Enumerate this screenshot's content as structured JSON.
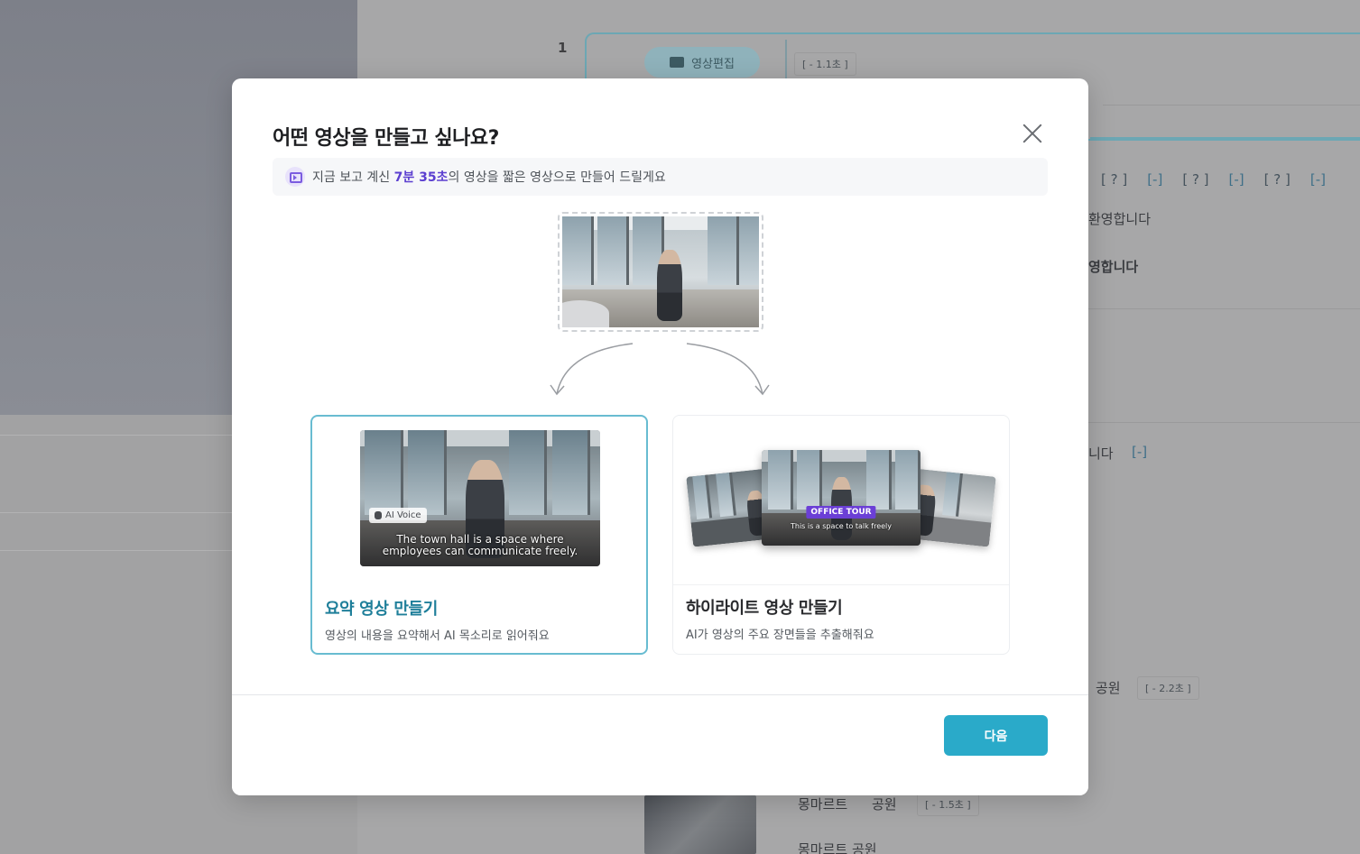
{
  "background": {
    "segment_number": "1",
    "segment_chip_label": "영상편집",
    "segment_time": "[ - 1.1초 ]",
    "tokens": [
      "[ ? ]",
      "[-]",
      "[ ? ]",
      "[-]",
      "[ ? ]",
      "[-]"
    ],
    "line_text_1": "환영합니다",
    "line_text_2": "영합니다",
    "line_text_3": "니다",
    "line_text_3_token": "[-]",
    "row_park_label": "공원",
    "row_park_time": "[ - 2.2초 ]",
    "row_bottom_word_1": "몽마르트",
    "row_bottom_word_2": "공원",
    "row_bottom_time": "[ - 1.5초 ]",
    "row_bottom_next": "몽마르트 공원"
  },
  "modal": {
    "title": "어떤 영상을 만들고 싶나요?",
    "info_prefix": "지금 보고 계신 ",
    "info_time": "7분 35초",
    "info_suffix": "의 영상을 짧은 영상으로 만들어 드릴게요",
    "options": [
      {
        "title": "요약 영상 만들기",
        "description": "영상의 내용을 요약해서 AI 목소리로 읽어줘요",
        "badge": "AI Voice",
        "caption_line1": "The town hall is a space where",
        "caption_line2": "employees can communicate freely.",
        "selected": true
      },
      {
        "title": "하이라이트 영상 만들기",
        "description": "AI가 영상의 주요 장면들을 추출해줘요",
        "tour_label": "OFFICE TOUR",
        "tour_subtitle": "This is a space to talk freely",
        "selected": false
      }
    ],
    "next_button": "다음"
  },
  "colors": {
    "accent": "#2aaac9",
    "selected_border": "#68bcd1",
    "highlight_time": "#5b3fd0",
    "tour_badge": "#6b3fd6"
  },
  "icons": {
    "close": "close-icon",
    "info": "video-convert-icon",
    "chip": "clapperboard-icon",
    "voice": "mic-icon"
  }
}
